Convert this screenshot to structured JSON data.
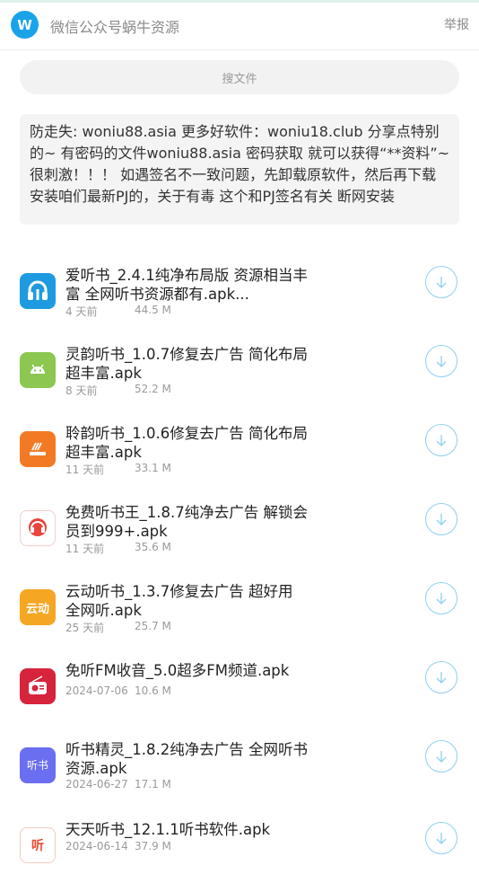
{
  "header": {
    "logo_letter": "W",
    "title": "微信公众号蜗牛资源",
    "report_label": "举报"
  },
  "search": {
    "label": "搜文件"
  },
  "notice": {
    "text": "防走失: woniu88.asia 更多好软件：woniu18.club 分享点特别的~ 有密码的文件woniu88.asia 密码获取 就可以获得“**资料”~ 很刺激！！！ 如遇签名不一致问题，先卸载原软件，然后再下载安装咱们最新PJ的，关于有毒 这个和PJ签名有关 断网安装"
  },
  "files": [
    {
      "name": "爱听书_2.4.1纯净布局版 资源相当丰富 全网听书资源都有.apk...",
      "time": "4 天前",
      "size": "44.5 M",
      "icon": "headphones-icon",
      "color": "#1e9be0"
    },
    {
      "name": "灵韵听书_1.0.7修复去广告 简化布局 超丰富.apk",
      "time": "8 天前",
      "size": "52.2 M",
      "icon": "android-icon",
      "color": "#8cc751"
    },
    {
      "name": "聆韵听书_1.0.6修复去广告 简化布局 超丰富.apk",
      "time": "11 天前",
      "size": "33.1 M",
      "icon": "book-wave-icon",
      "color": "#f27a24"
    },
    {
      "name": "免费听书王_1.8.7纯净去广告 解锁会员到999+.apk",
      "time": "11 天前",
      "size": "35.6 M",
      "icon": "headset-king-icon",
      "color": "#e8453c"
    },
    {
      "name": "云动听书_1.3.7修复去广告 超好用 全网听.apk",
      "time": "25 天前",
      "size": "25.7 M",
      "icon": "yundong-logo-icon",
      "color": "#f5a623",
      "icon_text": "云动"
    },
    {
      "name": "免听FM收音_5.0超多FM频道.apk",
      "time": "2024-07-06",
      "size": "10.6 M",
      "icon": "radio-icon",
      "color": "#d6243c"
    },
    {
      "name": "听书精灵_1.8.2纯净去广告 全网听书资源.apk",
      "time": "2024-06-27",
      "size": "17.1 M",
      "icon": "tingshu-jingling-icon",
      "color": "#6a6ef0",
      "icon_text": "听书"
    },
    {
      "name": "天天听书_12.1.1听书软件.apk",
      "time": "2024-06-14",
      "size": "37.9 M",
      "icon": "tiantian-logo-icon",
      "color": "#ea4a2e",
      "icon_text": "听"
    }
  ]
}
